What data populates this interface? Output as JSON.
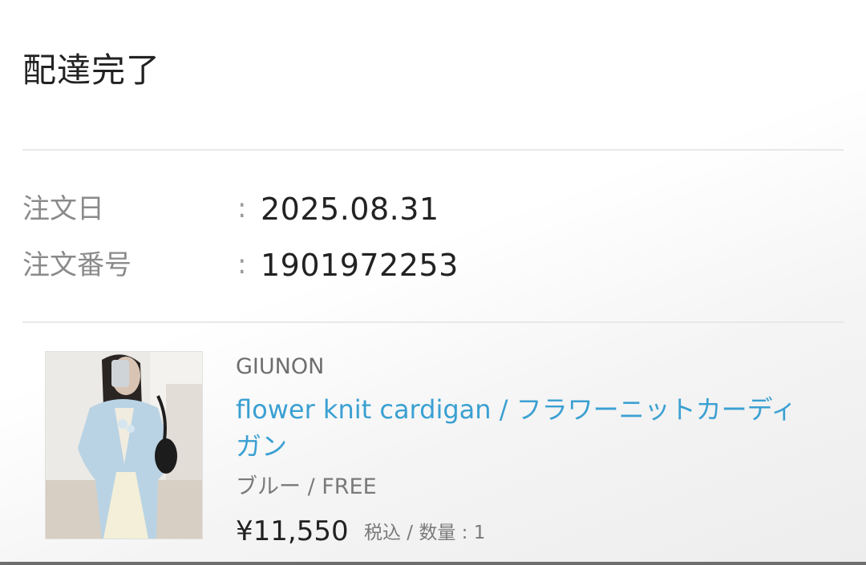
{
  "order_status": {
    "title": "配達完了"
  },
  "order_info": {
    "date_label": "注文日",
    "date_value": "2025.08.31",
    "number_label": "注文番号",
    "number_value": "1901972253",
    "separator": ":"
  },
  "product": {
    "brand": "GIUNON",
    "name": "flower knit cardigan / フラワーニットカーディガン",
    "variant": "ブルー / FREE",
    "price": "¥11,550",
    "price_note": "税込 / 数量 : 1",
    "image_icon": "product-photo-cardigan"
  },
  "colors": {
    "link": "#3aa0d2",
    "text": "#222222",
    "muted": "#8a8a8a",
    "divider": "#e8e8e8"
  }
}
